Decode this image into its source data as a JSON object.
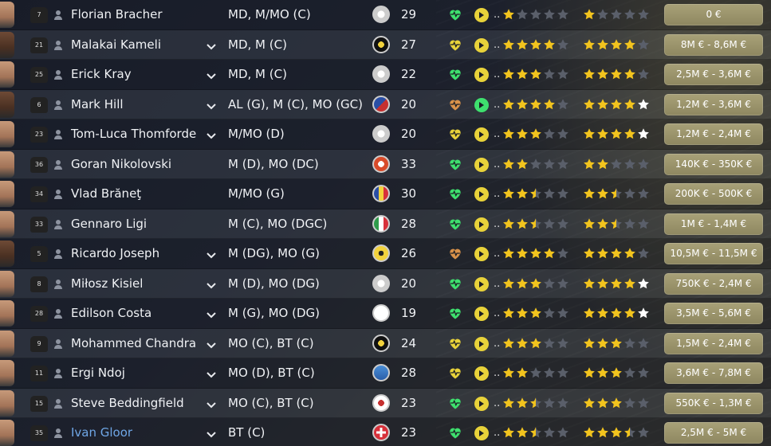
{
  "colors": {
    "star_full": "#f2c41e",
    "star_empty": "#5a5f6a",
    "star_white": "#ffffff",
    "condition_green": "#3ee06e",
    "condition_yellow": "#e8d23a",
    "condition_orange": "#d9924a",
    "value_bg": "#a39b70",
    "highlight_name": "#6fa6e6"
  },
  "players": [
    {
      "number": "7",
      "name": "Florian Bracher",
      "has_chevron": false,
      "position": "MD, M/MO (C)",
      "nation": "germany",
      "age": "29",
      "condition": "green",
      "morale": "yellow",
      "ca": 1.0,
      "pa": 1.0,
      "pa_white": 0,
      "value": "0 €",
      "avatar": "light"
    },
    {
      "number": "21",
      "name": "Malakai Kameli",
      "has_chevron": true,
      "position": "MD, M (C)",
      "nation": "club-black",
      "age": "27",
      "condition": "yellow",
      "morale": "yellow",
      "ca": 4.0,
      "pa": 4.0,
      "pa_white": 0,
      "value": "8M € - 8,6M €",
      "avatar": "dark"
    },
    {
      "number": "25",
      "name": "Erick Kray",
      "has_chevron": true,
      "position": "MD, M (C)",
      "nation": "germany",
      "age": "22",
      "condition": "green",
      "morale": "yellow",
      "ca": 3.0,
      "pa": 4.0,
      "pa_white": 0,
      "value": "2,5M € - 3,6M €",
      "avatar": "light"
    },
    {
      "number": "6",
      "name": "Mark Hill",
      "has_chevron": true,
      "position": "AL (G), M (C), MO (GC)",
      "nation": "club-blue-red",
      "age": "20",
      "condition": "orange",
      "morale": "green",
      "ca": 4.0,
      "pa": 4.0,
      "pa_white": 1,
      "value": "1,2M € - 3,6M €",
      "avatar": "dark"
    },
    {
      "number": "23",
      "name": "Tom-Luca Thomforde",
      "has_chevron": true,
      "position": "M/MO (D)",
      "nation": "germany",
      "age": "20",
      "condition": "yellow",
      "morale": "yellow",
      "ca": 3.0,
      "pa": 4.0,
      "pa_white": 1,
      "value": "1,2M € - 2,4M €",
      "avatar": "light"
    },
    {
      "number": "36",
      "name": "Goran Nikolovski",
      "has_chevron": false,
      "position": "M (D), MO (DC)",
      "nation": "club-red",
      "age": "33",
      "condition": "green",
      "morale": "yellow",
      "ca": 2.0,
      "pa": 2.0,
      "pa_white": 0,
      "value": "140K € - 350K €",
      "avatar": "light"
    },
    {
      "number": "34",
      "name": "Vlad Brăneţ",
      "has_chevron": false,
      "position": "M/MO (G)",
      "nation": "club-yellow",
      "age": "30",
      "condition": "green",
      "morale": "yellow",
      "ca": 2.5,
      "pa": 2.5,
      "pa_white": 0,
      "value": "200K € - 500K €",
      "avatar": "light"
    },
    {
      "number": "33",
      "name": "Gennaro Ligi",
      "has_chevron": false,
      "position": "M (C), MO (DGC)",
      "nation": "italy",
      "age": "28",
      "condition": "green",
      "morale": "yellow",
      "ca": 2.5,
      "pa": 2.5,
      "pa_white": 0,
      "value": "1M € - 1,4M €",
      "avatar": "light"
    },
    {
      "number": "5",
      "name": "Ricardo Joseph",
      "has_chevron": true,
      "position": "M (DG), MO (G)",
      "nation": "club-yellow-ball",
      "age": "26",
      "condition": "orange",
      "morale": "yellow",
      "ca": 4.0,
      "pa": 4.0,
      "pa_white": 0,
      "value": "10,5M € - 11,5M €",
      "avatar": "dark"
    },
    {
      "number": "8",
      "name": "Miłosz Kisiel",
      "has_chevron": true,
      "position": "M (D), MO (DG)",
      "nation": "germany",
      "age": "20",
      "condition": "green",
      "morale": "yellow",
      "ca": 3.0,
      "pa": 4.0,
      "pa_white": 1,
      "value": "750K € - 2,4M €",
      "avatar": "light"
    },
    {
      "number": "28",
      "name": "Edilson Costa",
      "has_chevron": true,
      "position": "M (G), MO (DG)",
      "nation": "france",
      "age": "19",
      "condition": "green",
      "morale": "yellow",
      "ca": 3.0,
      "pa": 4.0,
      "pa_white": 1,
      "value": "3,5M € - 5,6M €",
      "avatar": "light"
    },
    {
      "number": "9",
      "name": "Mohammed Chandra",
      "has_chevron": true,
      "position": "MO (C), BT (C)",
      "nation": "club-black",
      "age": "24",
      "condition": "yellow",
      "morale": "yellow",
      "ca": 3.0,
      "pa": 3.0,
      "pa_white": 0,
      "value": "1,5M € - 2,4M €",
      "avatar": "light"
    },
    {
      "number": "11",
      "name": "Ergi Ndoj",
      "has_chevron": true,
      "position": "MO (D), BT (C)",
      "nation": "club-blue",
      "age": "28",
      "condition": "yellow",
      "morale": "yellow",
      "ca": 2.0,
      "pa": 3.0,
      "pa_white": 0,
      "value": "3,6M € - 7,8M €",
      "avatar": "light"
    },
    {
      "number": "15",
      "name": "Steve Beddingfield",
      "has_chevron": true,
      "position": "MO (C), BT (C)",
      "nation": "club-red-white",
      "age": "23",
      "condition": "green",
      "morale": "yellow",
      "ca": 2.5,
      "pa": 3.0,
      "pa_white": 0,
      "value": "550K € - 1,3M €",
      "avatar": "light"
    },
    {
      "number": "35",
      "name": "Ivan Gloor",
      "has_chevron": true,
      "position": "BT (C)",
      "nation": "switzerland",
      "age": "23",
      "condition": "green",
      "morale": "yellow",
      "ca": 2.5,
      "pa": 3.5,
      "pa_white": 0,
      "value": "2,5M € - 5M €",
      "avatar": "light",
      "highlight": true
    }
  ],
  "dots_label": ".."
}
